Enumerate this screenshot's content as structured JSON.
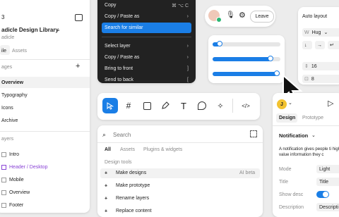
{
  "left": {
    "top_fragment": "3",
    "library_title": "adicle Design Library",
    "library_sub": "adicle",
    "tabs": [
      "ile",
      "Assets"
    ],
    "pages_header": "ages",
    "pages": [
      "Overview",
      "Typography",
      "Icons",
      "Archive"
    ],
    "layers_header": "ayers",
    "layers": [
      "Intro",
      "Header / Desktop",
      "Mobile",
      "Overview",
      "Footer"
    ]
  },
  "menu": {
    "items": [
      {
        "label": "Copy",
        "shortcut": "⌘ ⌥ C"
      },
      {
        "label": "Copy / Paste as",
        "shortcut": "›"
      },
      {
        "label": "Search for similar",
        "shortcut": ""
      },
      {
        "label": "Select layer",
        "shortcut": "›"
      },
      {
        "label": "Copy / Paste as",
        "shortcut": "›"
      },
      {
        "label": "Bring to front",
        "shortcut": "]"
      },
      {
        "label": "Send to back",
        "shortcut": "["
      }
    ]
  },
  "call": {
    "leave_label": "Leave"
  },
  "sliders": {
    "values": [
      0.1,
      0.85,
      0.95
    ]
  },
  "autolayout": {
    "title": "Auto layout",
    "w_label": "W",
    "w_value": "Hug",
    "gap_value": "16",
    "pad_value": "8"
  },
  "toolbar": {
    "code_label": "</>"
  },
  "search": {
    "placeholder": "Search",
    "tabs": [
      "All",
      "Assets",
      "Plugins & widgets"
    ],
    "section": "Design tools",
    "results": [
      {
        "label": "Make designs",
        "badge": "AI beta"
      },
      {
        "label": "Make prototype",
        "badge": ""
      },
      {
        "label": "Rename layers",
        "badge": ""
      },
      {
        "label": "Replace content",
        "badge": ""
      }
    ]
  },
  "design": {
    "avatar_letter": "J",
    "tabs": [
      "Design",
      "Prototype"
    ],
    "component": "Notification",
    "description": "A notification gives people ti high-value information they c",
    "props": [
      {
        "label": "Mode",
        "value": "Light"
      },
      {
        "label": "Title",
        "value": "Title"
      },
      {
        "label": "Show desc",
        "value": ""
      },
      {
        "label": "Description",
        "value": "Descripti"
      }
    ]
  },
  "colors": {
    "accent": "#1a7ee6",
    "menu_bg": "#222222",
    "avatar": "#f2c230"
  }
}
